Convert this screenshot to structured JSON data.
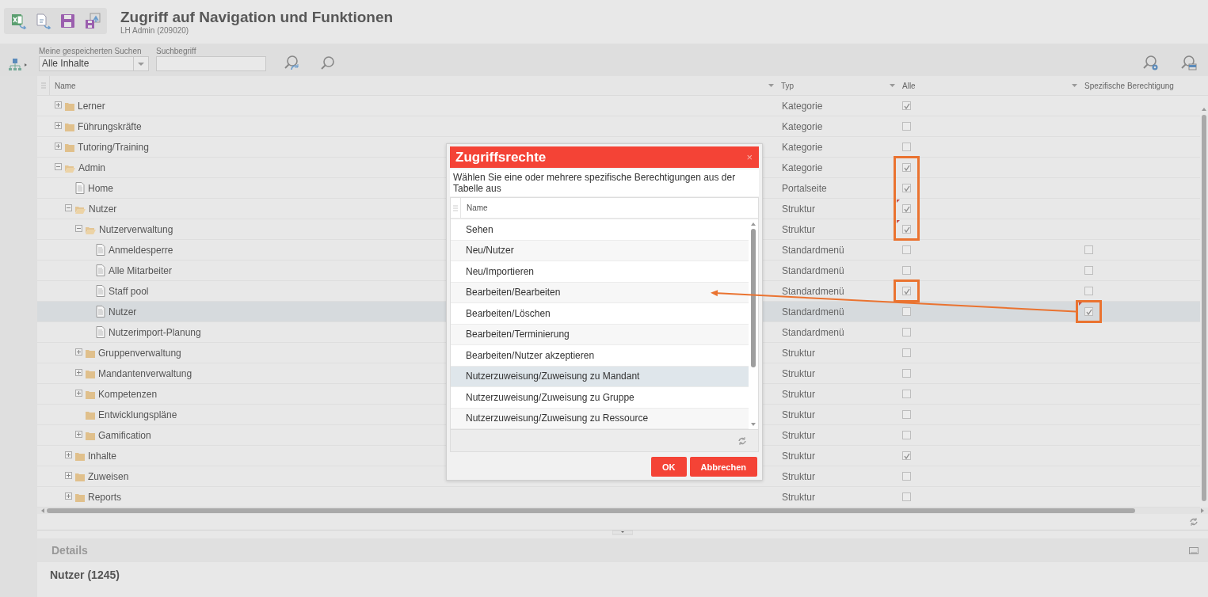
{
  "toolbar": {
    "title": "Zugriff auf Navigation und Funktionen",
    "subtitle": "LH Admin (209020)"
  },
  "search": {
    "saved_label": "Meine gespeicherten Suchen",
    "saved_value": "Alle Inhalte",
    "term_label": "Suchbegriff"
  },
  "tree": {
    "columns": [
      "Name",
      "Typ",
      "Alle",
      "Spezifische Berechtigung"
    ],
    "rows": [
      {
        "name": "Lerner",
        "kind": "folder",
        "expanded": false,
        "selected": false,
        "type": "Kategorie",
        "all": {
          "checked": true,
          "dirty": false,
          "highlighted": false
        }
      },
      {
        "name": "Führungskräfte",
        "kind": "folder",
        "expanded": false,
        "selected": false,
        "type": "Kategorie",
        "all": {
          "checked": false,
          "dirty": false,
          "highlighted": false
        }
      },
      {
        "name": "Tutoring/Training",
        "kind": "folder",
        "expanded": false,
        "selected": false,
        "type": "Kategorie",
        "all": {
          "checked": false,
          "dirty": false,
          "highlighted": false
        }
      },
      {
        "name": "Admin",
        "kind": "folder",
        "expanded": true,
        "selected": false,
        "type": "Kategorie",
        "all": {
          "checked": true,
          "dirty": false,
          "highlighted": true
        },
        "children": [
          {
            "name": "Home",
            "kind": "page",
            "selected": false,
            "type": "Portalseite",
            "all": {
              "checked": true,
              "dirty": false,
              "highlighted": true
            }
          },
          {
            "name": "Nutzer",
            "kind": "folder",
            "expanded": true,
            "selected": false,
            "type": "Struktur",
            "all": {
              "checked": true,
              "dirty": true,
              "highlighted": true
            },
            "children": [
              {
                "name": "Nutzerverwaltung",
                "kind": "folder",
                "expanded": true,
                "selected": false,
                "type": "Struktur",
                "all": {
                  "checked": true,
                  "dirty": true,
                  "highlighted": true
                },
                "children": [
                  {
                    "name": "Anmeldesperre",
                    "kind": "page",
                    "selected": false,
                    "type": "Standardmenü",
                    "all": {
                      "checked": false,
                      "dirty": false,
                      "highlighted": false
                    },
                    "specific": {
                      "checked": false,
                      "dirty": false,
                      "highlighted": false
                    }
                  },
                  {
                    "name": "Alle Mitarbeiter",
                    "kind": "page",
                    "selected": false,
                    "type": "Standardmenü",
                    "all": {
                      "checked": false,
                      "dirty": false,
                      "highlighted": false
                    },
                    "specific": {
                      "checked": false,
                      "dirty": false,
                      "highlighted": false
                    }
                  },
                  {
                    "name": "Staff pool",
                    "kind": "page",
                    "selected": false,
                    "type": "Standardmenü",
                    "all": {
                      "checked": true,
                      "dirty": false,
                      "highlighted": true
                    },
                    "specific": {
                      "checked": false,
                      "dirty": false,
                      "highlighted": false
                    }
                  },
                  {
                    "name": "Nutzer",
                    "kind": "page",
                    "selected": true,
                    "type": "Standardmenü",
                    "all": {
                      "checked": false,
                      "dirty": false,
                      "highlighted": false
                    },
                    "specific": {
                      "checked": true,
                      "dirty": true,
                      "highlighted": true
                    }
                  },
                  {
                    "name": "Nutzerimport-Planung",
                    "kind": "page",
                    "selected": false,
                    "type": "Standardmenü",
                    "all": {
                      "checked": false,
                      "dirty": false,
                      "highlighted": false
                    }
                  }
                ]
              },
              {
                "name": "Gruppenverwaltung",
                "kind": "folder",
                "expanded": false,
                "selected": false,
                "type": "Struktur",
                "all": {
                  "checked": false,
                  "dirty": false,
                  "highlighted": false
                }
              },
              {
                "name": "Mandantenverwaltung",
                "kind": "folder",
                "expanded": false,
                "selected": false,
                "type": "Struktur",
                "all": {
                  "checked": false,
                  "dirty": false,
                  "highlighted": false
                }
              },
              {
                "name": "Kompetenzen",
                "kind": "folder",
                "expanded": false,
                "selected": false,
                "type": "Struktur",
                "all": {
                  "checked": false,
                  "dirty": false,
                  "highlighted": false
                }
              },
              {
                "name": "Entwicklungspläne",
                "kind": "folder",
                "selected": false,
                "type": "Struktur",
                "all": {
                  "checked": false,
                  "dirty": false,
                  "highlighted": false
                }
              },
              {
                "name": "Gamification",
                "kind": "folder",
                "expanded": false,
                "selected": false,
                "type": "Struktur",
                "all": {
                  "checked": false,
                  "dirty": false,
                  "highlighted": false
                }
              }
            ]
          },
          {
            "name": "Inhalte",
            "kind": "folder",
            "expanded": false,
            "selected": false,
            "type": "Struktur",
            "all": {
              "checked": true,
              "dirty": false,
              "highlighted": false
            }
          },
          {
            "name": "Zuweisen",
            "kind": "folder",
            "expanded": false,
            "selected": false,
            "type": "Struktur",
            "all": {
              "checked": false,
              "dirty": false,
              "highlighted": false
            }
          },
          {
            "name": "Reports",
            "kind": "folder",
            "expanded": false,
            "selected": false,
            "type": "Struktur",
            "all": {
              "checked": false,
              "dirty": false,
              "highlighted": false
            }
          }
        ]
      }
    ]
  },
  "dialog": {
    "title": "Zugriffsrechte",
    "close": "×",
    "description": "Wählen Sie eine oder mehrere spezifische Berechtigungen aus der Tabelle aus",
    "column": "Name",
    "items": [
      {
        "label": "Sehen",
        "selected": false
      },
      {
        "label": "Neu/Nutzer",
        "selected": false
      },
      {
        "label": "Neu/Importieren",
        "selected": false
      },
      {
        "label": "Bearbeiten/Bearbeiten",
        "selected": false
      },
      {
        "label": "Bearbeiten/Löschen",
        "selected": false
      },
      {
        "label": "Bearbeiten/Terminierung",
        "selected": false
      },
      {
        "label": "Bearbeiten/Nutzer akzeptieren",
        "selected": false
      },
      {
        "label": "Nutzerzuweisung/Zuweisung zu Mandant",
        "selected": true
      },
      {
        "label": "Nutzerzuweisung/Zuweisung zu Gruppe",
        "selected": false
      },
      {
        "label": "Nutzerzuweisung/Zuweisung zu Ressource",
        "selected": false
      }
    ],
    "buttons": [
      "OK",
      "Abbrechen"
    ]
  },
  "details": {
    "title": "Details"
  },
  "list_title": "Nutzer (1245)"
}
